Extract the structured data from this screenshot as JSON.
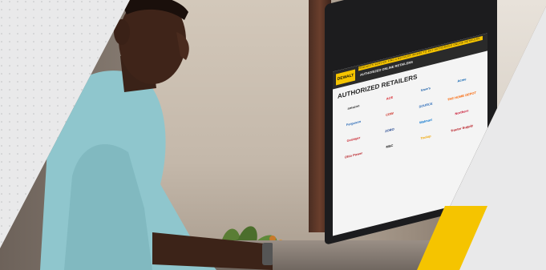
{
  "screen": {
    "brand": "DEWALT",
    "nav_text": "PRODUCTS  SERVICE  FIND A RETAILER  WHERE TO BUY  AUTHORIZED ONLINE RETAILERS",
    "page_heading": "AUTHORIZED ONLINE RETAILERS",
    "section_title": "AUTHORIZED RETAILERS",
    "retailers": [
      {
        "name": "amazon",
        "color": "#2b2b2b"
      },
      {
        "name": "ACE",
        "color": "#d71920"
      },
      {
        "name": "lowe's",
        "color": "#1a5fa8"
      },
      {
        "name": "Acme",
        "color": "#0a62b0"
      },
      {
        "name": "Ferguson",
        "color": "#1e62b3"
      },
      {
        "name": "CDW",
        "color": "#cc2a1f"
      },
      {
        "name": "SOURCE",
        "color": "#2a6ab8"
      },
      {
        "name": "THE HOME DEPOT",
        "color": "#f96302"
      },
      {
        "name": "Grainger",
        "color": "#c8202b"
      },
      {
        "name": "ZORO",
        "color": "#1a3f8b"
      },
      {
        "name": "Walmart",
        "color": "#0071ce"
      },
      {
        "name": "Northern",
        "color": "#c8102e"
      },
      {
        "name": "Ohio Power",
        "color": "#b81f25"
      },
      {
        "name": "MSC",
        "color": "#111111"
      },
      {
        "name": "Toolup",
        "color": "#f0a500"
      },
      {
        "name": "Tractor Supply",
        "color": "#b5121b"
      }
    ]
  },
  "colors": {
    "accent": "#f5c400",
    "background": "#e9e9ea"
  }
}
